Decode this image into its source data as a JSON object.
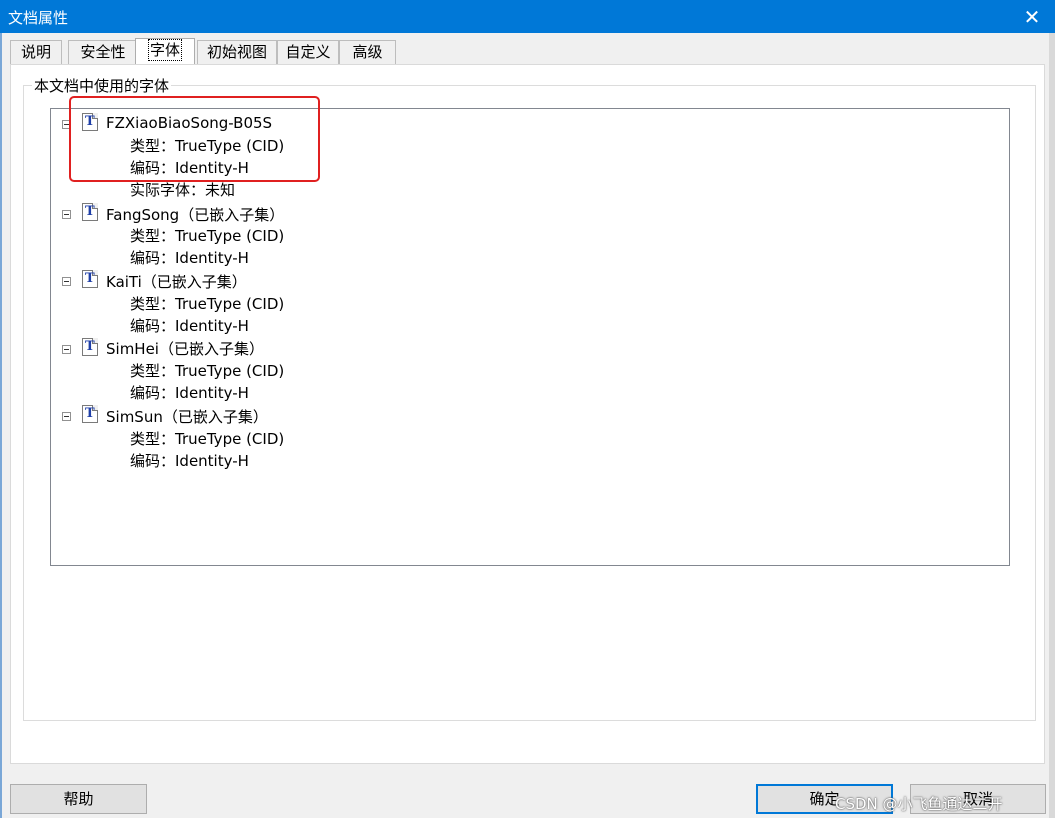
{
  "window": {
    "title": "文档属性",
    "close_glyph": "✕"
  },
  "tabs": [
    "说明",
    "安全性",
    "字体",
    "初始视图",
    "自定义",
    "高级"
  ],
  "active_tab": "字体",
  "group": {
    "legend": "本文档中使用的字体"
  },
  "fonts": [
    {
      "name": "FZXiaoBiaoSong-B05S",
      "type": "类型：TrueType (CID)",
      "encoding": "编码：Identity-H",
      "actual": "实际字体：未知"
    },
    {
      "name": "FangSong（已嵌入子集）",
      "type": "类型：TrueType (CID)",
      "encoding": "编码：Identity-H"
    },
    {
      "name": "KaiTi（已嵌入子集）",
      "type": "类型：TrueType (CID)",
      "encoding": "编码：Identity-H"
    },
    {
      "name": "SimHei（已嵌入子集）",
      "type": "类型：TrueType (CID)",
      "encoding": "编码：Identity-H"
    },
    {
      "name": "SimSun（已嵌入子集）",
      "type": "类型：TrueType (CID)",
      "encoding": "编码：Identity-H"
    }
  ],
  "buttons": {
    "help": "帮助",
    "ok": "确定",
    "cancel": "取消"
  },
  "watermark": "CSDN @小飞鱼通达二开",
  "colors": {
    "titlebar": "#0078d7",
    "highlight": "#e02020",
    "font_icon": "#1f3fa8"
  }
}
